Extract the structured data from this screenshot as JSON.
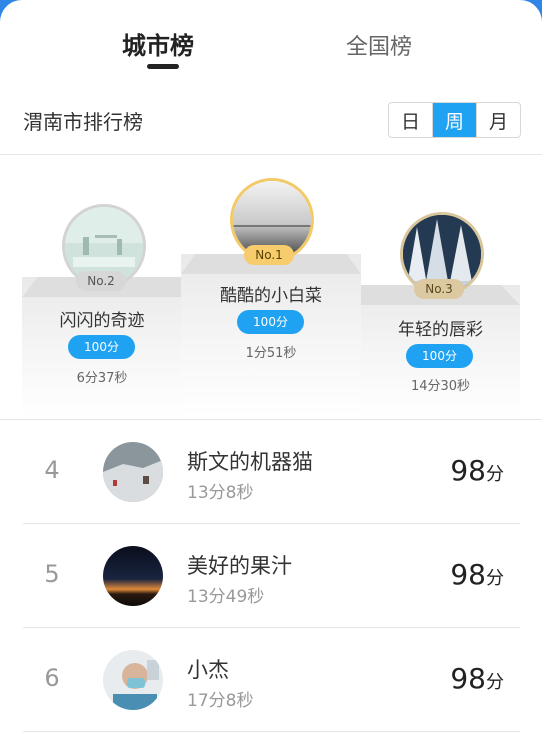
{
  "tabs": [
    {
      "label": "城市榜",
      "active": true
    },
    {
      "label": "全国榜",
      "active": false
    }
  ],
  "header": {
    "city_title": "渭南市排行榜",
    "periods": [
      "日",
      "周",
      "月"
    ],
    "selected_period": "周"
  },
  "podium": [
    {
      "place": "No.1",
      "name": "酷酷的小白菜",
      "score": "100分",
      "time": "1分51秒"
    },
    {
      "place": "No.2",
      "name": "闪闪的奇迹",
      "score": "100分",
      "time": "6分37秒"
    },
    {
      "place": "No.3",
      "name": "年轻的唇彩",
      "score": "100分",
      "time": "14分30秒"
    }
  ],
  "list": [
    {
      "rank": "4",
      "name": "斯文的机器猫",
      "time": "13分8秒",
      "score": "98",
      "unit": "分"
    },
    {
      "rank": "5",
      "name": "美好的果汁",
      "time": "13分49秒",
      "score": "98",
      "unit": "分"
    },
    {
      "rank": "6",
      "name": "小杰",
      "time": "17分8秒",
      "score": "98",
      "unit": "分"
    }
  ],
  "colors": {
    "accent": "#1fa2f2",
    "gold": "#f2ca67",
    "silver": "#d3d3d3",
    "bronze": "#d9c69c"
  }
}
